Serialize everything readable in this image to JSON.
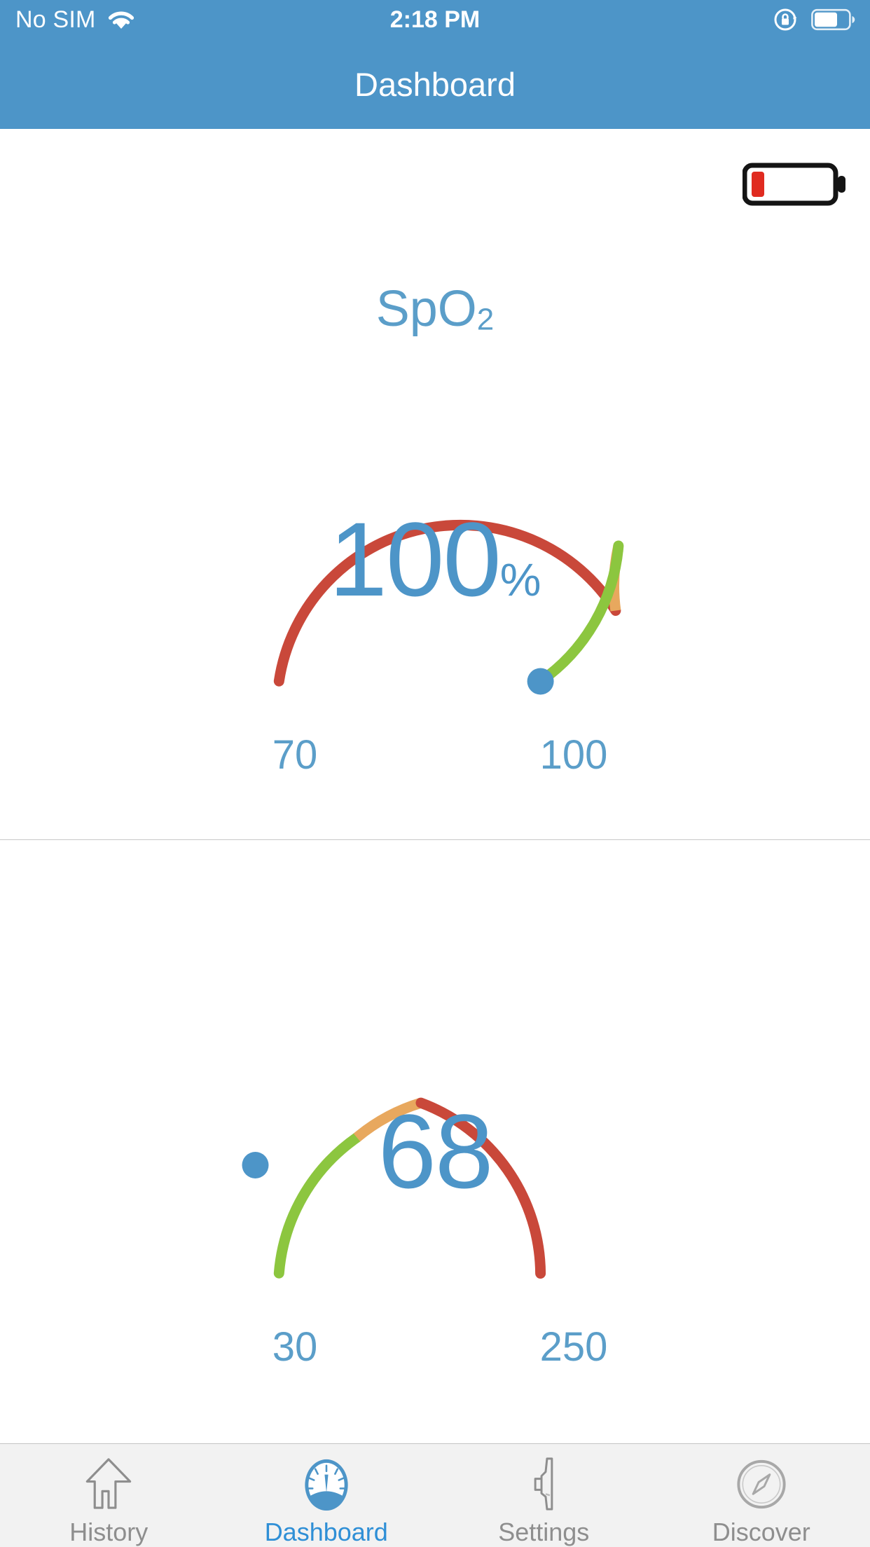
{
  "status_bar": {
    "carrier": "No SIM",
    "wifi_icon": "wifi-icon",
    "time": "2:18 PM",
    "rotation_lock_icon": "rotation-lock-icon",
    "battery_icon": "battery-icon",
    "battery_level_pct": 62
  },
  "header": {
    "title": "Dashboard",
    "background_color": "#4d95c8"
  },
  "device_battery": {
    "icon": "device-battery-low-icon",
    "level_pct": 13,
    "fill_color": "#e02b20",
    "outline_color": "#1a1a1a"
  },
  "colors": {
    "accent_blue": "#4d95c8",
    "label_blue": "#5b9ec9",
    "zone_red": "#c9483a",
    "zone_orange": "#e8a85e",
    "zone_green": "#8cc63f",
    "tab_inactive": "#8e8e8e",
    "tab_active": "#2f8fd6",
    "tabbar_bg": "#f2f2f2",
    "divider": "#c8c8c8"
  },
  "gauges": [
    {
      "title_main": "SpO",
      "title_sub": "2",
      "value": "100",
      "unit": "%",
      "min_label": "70",
      "max_label": "100",
      "marker_position": "max"
    },
    {
      "title_main": "",
      "title_sub": "",
      "value": "68",
      "unit": "",
      "min_label": "30",
      "max_label": "250",
      "marker_position": "left"
    }
  ],
  "chart_data": [
    {
      "type": "gauge",
      "title": "SpO2",
      "value": 100,
      "unit": "%",
      "min": 70,
      "max": 100,
      "ylim": [
        70,
        100
      ],
      "marker_value": 100,
      "zones": [
        {
          "name": "low-critical",
          "color": "#c9483a",
          "from_angle_deg": 215,
          "to_angle_deg": 10
        },
        {
          "name": "caution",
          "color": "#e8a85e",
          "from_angle_deg": 10,
          "to_angle_deg": 50
        },
        {
          "name": "normal",
          "color": "#8cc63f",
          "from_angle_deg": 50,
          "to_angle_deg": 145
        }
      ],
      "tick_labels": [
        "70",
        "100"
      ],
      "legend": []
    },
    {
      "type": "gauge",
      "title": "",
      "value": 68,
      "unit": "",
      "min": 30,
      "max": 250,
      "ylim": [
        30,
        250
      ],
      "marker_value": 68,
      "zones": [
        {
          "name": "normal",
          "color": "#8cc63f",
          "from_angle_deg": 215,
          "to_angle_deg": 310
        },
        {
          "name": "caution",
          "color": "#e8a85e",
          "from_angle_deg": 310,
          "to_angle_deg": 350
        },
        {
          "name": "high-critical",
          "color": "#c9483a",
          "from_angle_deg": 350,
          "to_angle_deg": 145
        }
      ],
      "tick_labels": [
        "30",
        "250"
      ],
      "legend": []
    }
  ],
  "tabbar": {
    "items": [
      {
        "icon": "home-history-icon",
        "label": "History",
        "active": false
      },
      {
        "icon": "gauge-dashboard-icon",
        "label": "Dashboard",
        "active": true
      },
      {
        "icon": "sensor-settings-icon",
        "label": "Settings",
        "active": false
      },
      {
        "icon": "compass-discover-icon",
        "label": "Discover",
        "active": false
      }
    ]
  }
}
